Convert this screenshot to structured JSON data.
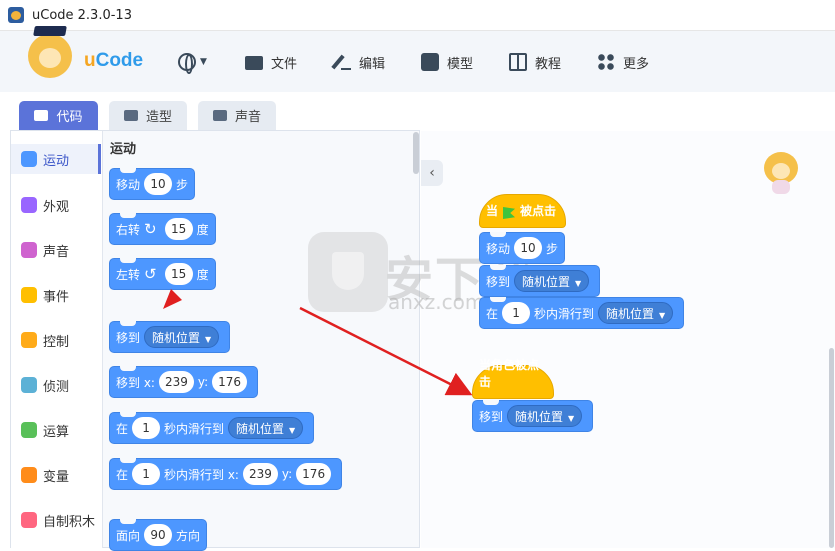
{
  "window": {
    "title": "uCode 2.3.0-13"
  },
  "brand": {
    "logo_part1": "u",
    "logo_part2": "Code"
  },
  "nav": [
    {
      "label": "",
      "icon": "globe-icon"
    },
    {
      "label": "文件",
      "icon": "folder-icon"
    },
    {
      "label": "编辑",
      "icon": "edit-icon"
    },
    {
      "label": "模型",
      "icon": "puzzle-icon"
    },
    {
      "label": "教程",
      "icon": "book-icon"
    },
    {
      "label": "更多",
      "icon": "grid-icon"
    }
  ],
  "tabs": [
    {
      "label": "代码",
      "active": true
    },
    {
      "label": "造型",
      "active": false
    },
    {
      "label": "声音",
      "active": false
    }
  ],
  "categories": [
    {
      "label": "运动",
      "color": "#4d97ff",
      "active": true
    },
    {
      "label": "外观",
      "color": "#9966ff",
      "active": false
    },
    {
      "label": "声音",
      "color": "#cf63cf",
      "active": false
    },
    {
      "label": "事件",
      "color": "#ffbf00",
      "active": false
    },
    {
      "label": "控制",
      "color": "#ffab19",
      "active": false
    },
    {
      "label": "侦测",
      "color": "#5cb1d6",
      "active": false
    },
    {
      "label": "运算",
      "color": "#59c059",
      "active": false
    },
    {
      "label": "变量",
      "color": "#ff8c1a",
      "active": false
    },
    {
      "label": "自制积木",
      "color": "#ff6680",
      "active": false
    }
  ],
  "palette": {
    "title": "运动",
    "move": {
      "label": "移动",
      "value": "10",
      "unit": "步"
    },
    "turn_right": {
      "label": "右转",
      "value": "15",
      "unit": "度"
    },
    "turn_left": {
      "label": "左转",
      "value": "15",
      "unit": "度"
    },
    "goto": {
      "label": "移到",
      "option": "随机位置"
    },
    "goto_xy": {
      "label": "移到 x:",
      "x": "239",
      "ylabel": "y:",
      "y": "176"
    },
    "glide": {
      "label": "在",
      "secs": "1",
      "mid": "秒内滑行到",
      "option": "随机位置"
    },
    "glide_xy": {
      "label": "在",
      "secs": "1",
      "mid": "秒内滑行到 x:",
      "x": "239",
      "ylabel": "y:",
      "y": "176"
    },
    "point": {
      "label": "面向",
      "value": "90",
      "unit": "方向"
    }
  },
  "script1": {
    "hat_prefix": "当",
    "hat_suffix": "被点击",
    "move": {
      "label": "移动",
      "value": "10",
      "unit": "步"
    },
    "goto": {
      "label": "移到",
      "option": "随机位置"
    },
    "glide": {
      "label": "在",
      "secs": "1",
      "mid": "秒内滑行到",
      "option": "随机位置"
    }
  },
  "script2": {
    "hat": "当角色被点击",
    "goto": {
      "label": "移到",
      "option": "随机位置"
    }
  },
  "watermark": {
    "text": "安下载",
    "sub": "anxz.com"
  },
  "colors": {
    "motion": "#4d97ff",
    "events": "#ffbf00",
    "accent": "#5b73d9",
    "arrow": "#e02020"
  }
}
